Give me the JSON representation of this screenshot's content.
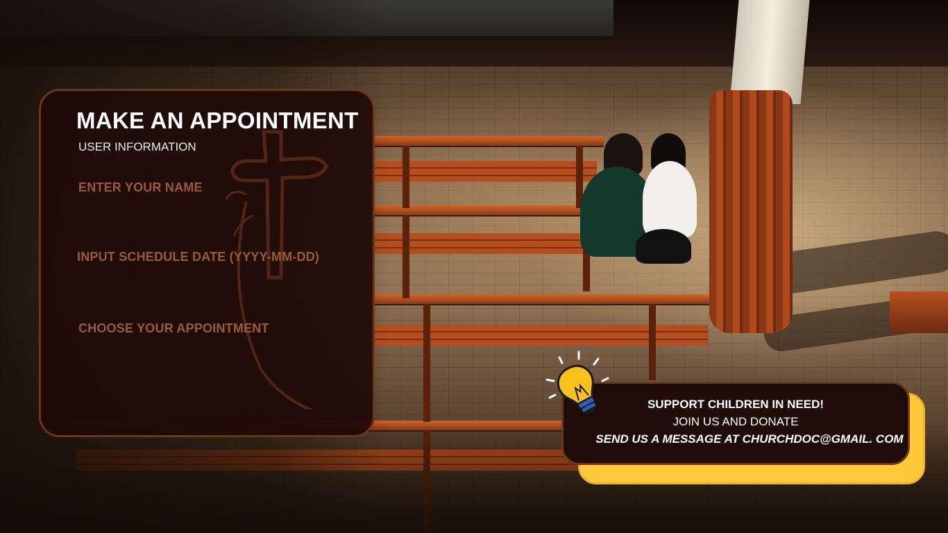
{
  "appointment_form": {
    "title": "MAKE AN APPOINTMENT",
    "subtitle": "USER INFORMATION",
    "fields": {
      "name": "ENTER YOUR NAME",
      "date": "INPUT SCHEDULE DATE (YYYY-MM-DD)",
      "appointment": "CHOOSE YOUR APPOINTMENT"
    }
  },
  "donate_banner": {
    "headline": "SUPPORT CHILDREN IN NEED!",
    "subline": "JOIN US AND DONATE",
    "contact": "SEND US A MESSAGE AT CHURCHDOC@GMAIL. COM",
    "accent_color": "#fdc93a",
    "icon": "lightbulb-icon"
  },
  "colors": {
    "panel_bg": "#1e0a06",
    "panel_border": "#6b3716",
    "label_color": "#9a5b3a"
  }
}
